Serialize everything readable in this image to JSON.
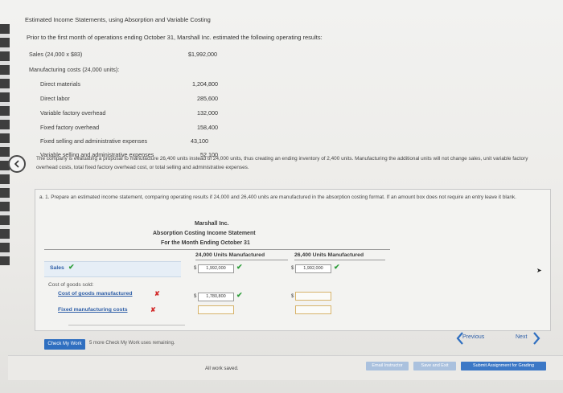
{
  "header": {
    "title": "Estimated Income Statements, using Absorption and Variable Costing"
  },
  "intro": "Prior to the first month of operations ending October 31, Marshall Inc. estimated the following operating results:",
  "results": {
    "sales_label": "Sales (24,000 x $83)",
    "sales_value": "$1,992,000",
    "mfg_label": "Manufacturing costs (24,000 units):",
    "items": [
      {
        "label": "Direct materials",
        "value": "1,204,800"
      },
      {
        "label": "Direct labor",
        "value": "285,600"
      },
      {
        "label": "Variable factory overhead",
        "value": "132,000"
      },
      {
        "label": "Fixed factory overhead",
        "value": "158,400"
      }
    ],
    "fixed_sga_label": "Fixed selling and administrative expenses",
    "fixed_sga_value": "43,100",
    "var_sga_label": "Variable selling and administrative expenses",
    "var_sga_value": "52,100"
  },
  "description": "The company is evaluating a proposal to manufacture 26,400 units instead of 24,000 units, thus creating an ending inventory of 2,400 units. Manufacturing the additional units will not change sales, unit variable factory overhead costs, total fixed factory overhead cost, or total selling and administrative expenses.",
  "question": {
    "text": "a. 1. Prepare an estimated income statement, comparing operating results if 24,000 and 26,400 units are manufactured in the absorption costing format. If an amount box does not require an entry leave it blank.",
    "company": "Marshall Inc.",
    "statement": "Absorption Costing Income Statement",
    "period": "For the Month Ending October 31",
    "col1": "24,000 Units Manufactured",
    "col2": "26,400 Units Manufactured",
    "rows": {
      "sales": "Sales",
      "cogs": "Cost of goods sold:",
      "cogm": "Cost of goods manufactured",
      "fixed_mfg": "Fixed manufacturing costs"
    },
    "inputs": {
      "sales_24": "1,992,000",
      "sales_26": "1,992,000",
      "cogm_24": "1,780,800",
      "cogm_26": "",
      "fixed_24": "",
      "fixed_26": ""
    },
    "dollar": "$"
  },
  "controls": {
    "check_my_work": "Check My Work",
    "remaining": "5 more Check My Work uses remaining.",
    "previous": "Previous",
    "next": "Next"
  },
  "footer": {
    "saved": "All work saved.",
    "email": "Email Instructor",
    "save_exit": "Save and Exit",
    "submit": "Submit Assignment for Grading"
  },
  "colors": {
    "accent": "#2f6fc0",
    "correct": "#2e9e3b",
    "incorrect": "#d22a2a"
  }
}
